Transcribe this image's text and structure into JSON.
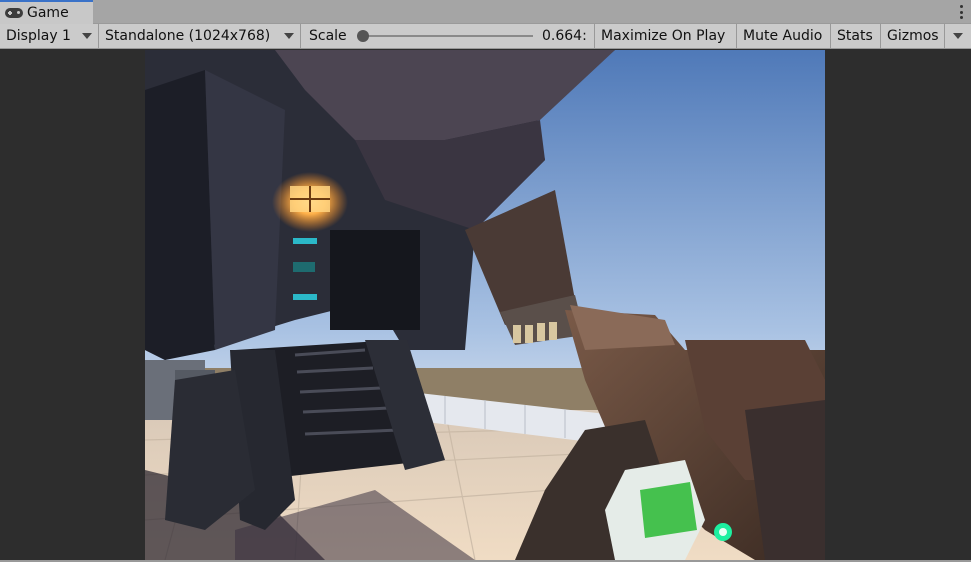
{
  "tab": {
    "title": "Game",
    "icon": "gamepad-icon"
  },
  "toolbar": {
    "display": "Display 1",
    "resolution": "Standalone (1024x768)",
    "scale_label": "Scale",
    "scale_value": "0.664:",
    "maximize": "Maximize On Play",
    "mute": "Mute Audio",
    "stats": "Stats",
    "gizmos": "Gizmos"
  },
  "colors": {
    "accent": "#3a72c8",
    "toolbar_bg": "#cbcbcb",
    "panel_bg": "#2d2d2d"
  }
}
